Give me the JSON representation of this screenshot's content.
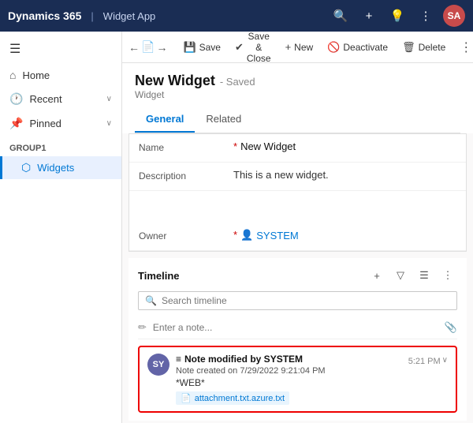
{
  "topnav": {
    "brand": "Dynamics 365",
    "divider": "|",
    "appname": "Widget App",
    "search_icon": "🔍",
    "add_icon": "+",
    "bell_icon": "💡",
    "more_icon": "⋮",
    "avatar": "SA"
  },
  "sidebar": {
    "hamburger": "☰",
    "home_icon": "⌂",
    "home_label": "Home",
    "recent_icon": "🕐",
    "recent_label": "Recent",
    "recent_chevron": "∨",
    "pinned_icon": "📌",
    "pinned_label": "Pinned",
    "pinned_chevron": "∨",
    "group_label": "Group1",
    "widgets_icon": "⬡",
    "widgets_label": "Widgets"
  },
  "commandbar": {
    "back_icon": "←",
    "page_icon": "📄",
    "forward_icon": "→",
    "save_label": "Save",
    "save_close_label": "Save & Close",
    "new_label": "New",
    "deactivate_label": "Deactivate",
    "delete_label": "Delete",
    "more_icon": "⋮"
  },
  "form": {
    "title": "New Widget",
    "saved_label": "- Saved",
    "subtitle": "Widget",
    "tabs": [
      {
        "label": "General",
        "active": true
      },
      {
        "label": "Related",
        "active": false
      }
    ],
    "fields": [
      {
        "label": "Name",
        "required": true,
        "value": "New Widget",
        "type": "text"
      },
      {
        "label": "Description",
        "required": false,
        "value": "This is a new widget.",
        "type": "description"
      }
    ],
    "owner_label": "Owner",
    "owner_required": true,
    "owner_icon": "👤",
    "owner_value": "SYSTEM"
  },
  "timeline": {
    "title": "Timeline",
    "add_icon": "+",
    "filter_icon": "▽",
    "list_icon": "☰",
    "more_icon": "⋮",
    "search_placeholder": "Search timeline",
    "search_icon": "🔍",
    "note_placeholder": "Enter a note...",
    "pencil_icon": "✏",
    "attach_icon": "📎",
    "entry": {
      "avatar_text": "SY",
      "note_icon": "≡",
      "title": "Note modified by SYSTEM",
      "meta": "Note created on 7/29/2022 9:21:04 PM",
      "body": "*WEB*",
      "attachment_icon": "📄",
      "attachment_label": "attachment.txt.azure.txt",
      "time": "5:21 PM",
      "expand_icon": "∨"
    }
  }
}
